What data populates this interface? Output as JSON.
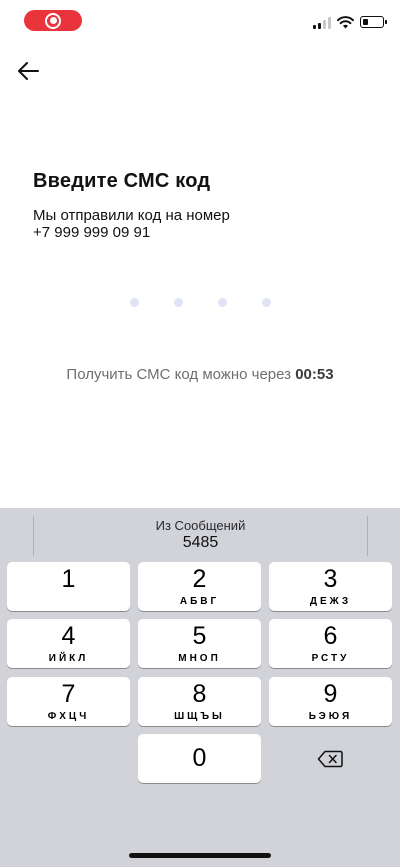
{
  "status_bar": {
    "recording_icon": "screen-recording-icon",
    "signal_icon": "cellular-signal-icon",
    "wifi_icon": "wifi-icon",
    "battery_icon": "battery-icon",
    "battery_level": 0.2,
    "recording_color": "#e9343c"
  },
  "header": {
    "back_icon": "arrow-left-icon"
  },
  "main": {
    "title": "Введите СМС код",
    "subtitle_line1": "Мы отправили код на номер",
    "phone": "+7 999 999 09 91",
    "code_length": 4,
    "code_entered": 0,
    "resend_prefix": "Получить СМС код можно через",
    "resend_timer": "00:53"
  },
  "keyboard": {
    "suggestion_label": "Из Сообщений",
    "suggestion_code": "5485",
    "keys": [
      {
        "digit": "1",
        "letters": ""
      },
      {
        "digit": "2",
        "letters": "АБВГ"
      },
      {
        "digit": "3",
        "letters": "ДЕЖЗ"
      },
      {
        "digit": "4",
        "letters": "ИЙКЛ"
      },
      {
        "digit": "5",
        "letters": "МНОП"
      },
      {
        "digit": "6",
        "letters": "РСТУ"
      },
      {
        "digit": "7",
        "letters": "ФХЦЧ"
      },
      {
        "digit": "8",
        "letters": "ШЩЪЫ"
      },
      {
        "digit": "9",
        "letters": "ЬЭЮЯ"
      }
    ],
    "zero": "0",
    "backspace_icon": "backspace-icon"
  }
}
